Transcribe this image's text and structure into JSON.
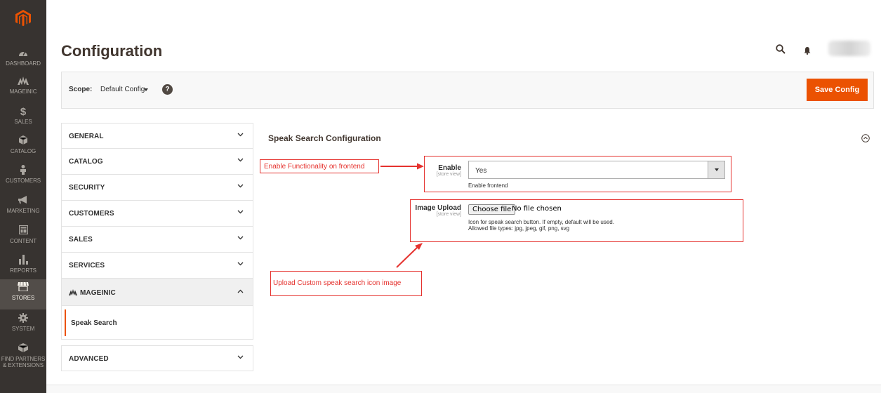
{
  "nav": {
    "items": [
      {
        "label": "DASHBOARD",
        "icon": "dashboard-icon"
      },
      {
        "label": "MAGEINIC",
        "icon": "mageinic-icon"
      },
      {
        "label": "SALES",
        "icon": "dollar-icon"
      },
      {
        "label": "CATALOG",
        "icon": "box-icon"
      },
      {
        "label": "CUSTOMERS",
        "icon": "person-icon"
      },
      {
        "label": "MARKETING",
        "icon": "megaphone-icon"
      },
      {
        "label": "CONTENT",
        "icon": "layout-icon"
      },
      {
        "label": "REPORTS",
        "icon": "bar-chart-icon"
      },
      {
        "label": "STORES",
        "icon": "store-icon"
      },
      {
        "label": "SYSTEM",
        "icon": "gear-icon"
      },
      {
        "label": "FIND PARTNERS",
        "label2": "& EXTENSIONS",
        "icon": "extensions-icon"
      }
    ],
    "active": "STORES"
  },
  "header": {
    "title": "Configuration"
  },
  "scope": {
    "label": "Scope:",
    "value": "Default Config",
    "help": "?"
  },
  "toolbar": {
    "save_label": "Save Config"
  },
  "tabs": {
    "general": "GENERAL",
    "catalog": "CATALOG",
    "security": "SECURITY",
    "customers": "CUSTOMERS",
    "sales": "SALES",
    "services": "SERVICES",
    "mageinic": "MAGEINIC",
    "speak_search": "Speak Search",
    "advanced": "ADVANCED"
  },
  "section": {
    "title": "Speak Search Configuration",
    "enable": {
      "label": "Enable",
      "scope": "[store view]",
      "value": "Yes",
      "note": "Enable frontend"
    },
    "image_upload": {
      "label": "Image Upload",
      "scope": "[store view]",
      "button": "Choose file",
      "status": "No file chosen",
      "note1": "Icon for speak search button. If empty, default will be used.",
      "note2": "Allowed file types: jpg, jpeg, gif, png, svg"
    }
  },
  "annotations": {
    "enable": "Enable Functionality on frontend",
    "upload": "Upload Custom speak search icon image"
  },
  "colors": {
    "nav_bg": "#373330",
    "accent": "#eb5202",
    "annotation": "#e5322e"
  }
}
